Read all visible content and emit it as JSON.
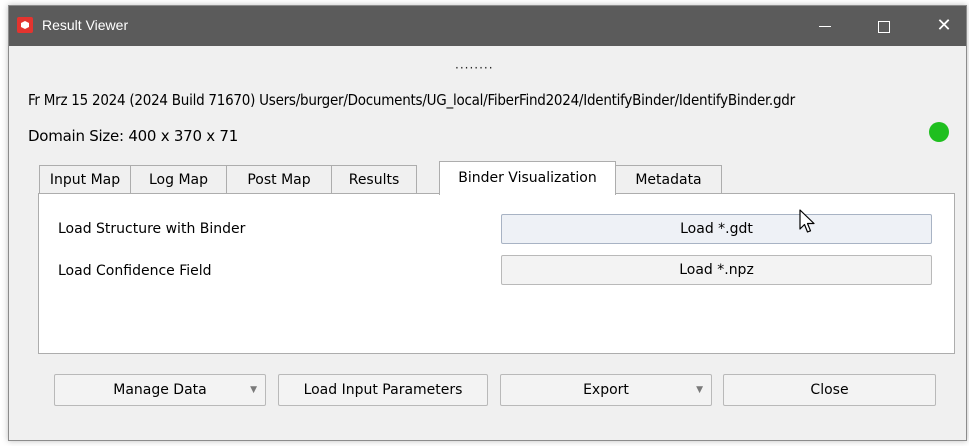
{
  "window": {
    "title": "Result Viewer",
    "controls": {
      "minimize": "—",
      "maximize": "□",
      "close": "✕"
    }
  },
  "splitter": {
    "handle": "········"
  },
  "info": {
    "build_path": "Fr Mrz 15 2024 (2024 Build 71670)  Users/burger/Documents/UG_local/FiberFind2024/IdentifyBinder/IdentifyBinder.gdr",
    "domain_size": "Domain Size: 400 x 370 x 71",
    "status_color": "#1fbf1f"
  },
  "tabs": [
    {
      "label": "Input Map",
      "active": false
    },
    {
      "label": "Log Map",
      "active": false
    },
    {
      "label": "Post Map",
      "active": false
    },
    {
      "label": "Results",
      "active": false
    },
    {
      "label": "Binder Visualization",
      "active": true
    },
    {
      "label": "Metadata",
      "active": false
    }
  ],
  "panel": {
    "rows": [
      {
        "label": "Load Structure with Binder",
        "button": "Load *.gdt"
      },
      {
        "label": "Load Confidence Field",
        "button": "Load *.npz"
      }
    ]
  },
  "bottom_buttons": {
    "manage_data": "Manage Data",
    "load_input_parameters": "Load Input Parameters",
    "export": "Export",
    "close": "Close",
    "dropdown_arrow": "▼"
  }
}
